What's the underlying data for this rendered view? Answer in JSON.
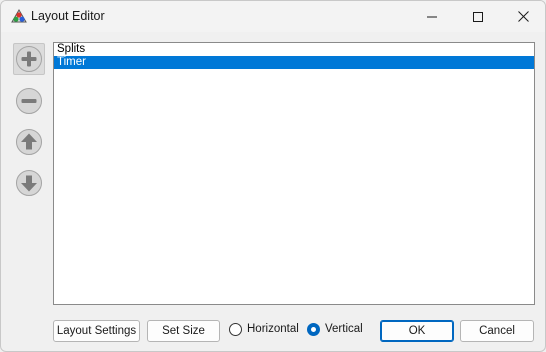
{
  "window": {
    "title": "Layout Editor",
    "icon": "livesplit-app-icon"
  },
  "sidebar": {
    "buttons": [
      {
        "name": "add-button",
        "icon": "plus-icon"
      },
      {
        "name": "remove-button",
        "icon": "minus-icon"
      },
      {
        "name": "move-up-button",
        "icon": "arrow-up-icon"
      },
      {
        "name": "move-down-button",
        "icon": "arrow-down-icon"
      }
    ]
  },
  "components": {
    "items": [
      "Splits",
      "Timer"
    ],
    "selected_index": 1
  },
  "footer": {
    "layout_settings_label": "Layout Settings",
    "set_size_label": "Set Size",
    "orientation": {
      "horizontal_label": "Horizontal",
      "vertical_label": "Vertical",
      "selected": "Vertical"
    },
    "ok_label": "OK",
    "cancel_label": "Cancel"
  },
  "colors": {
    "selection": "#0078d7",
    "accent": "#0067c0"
  }
}
